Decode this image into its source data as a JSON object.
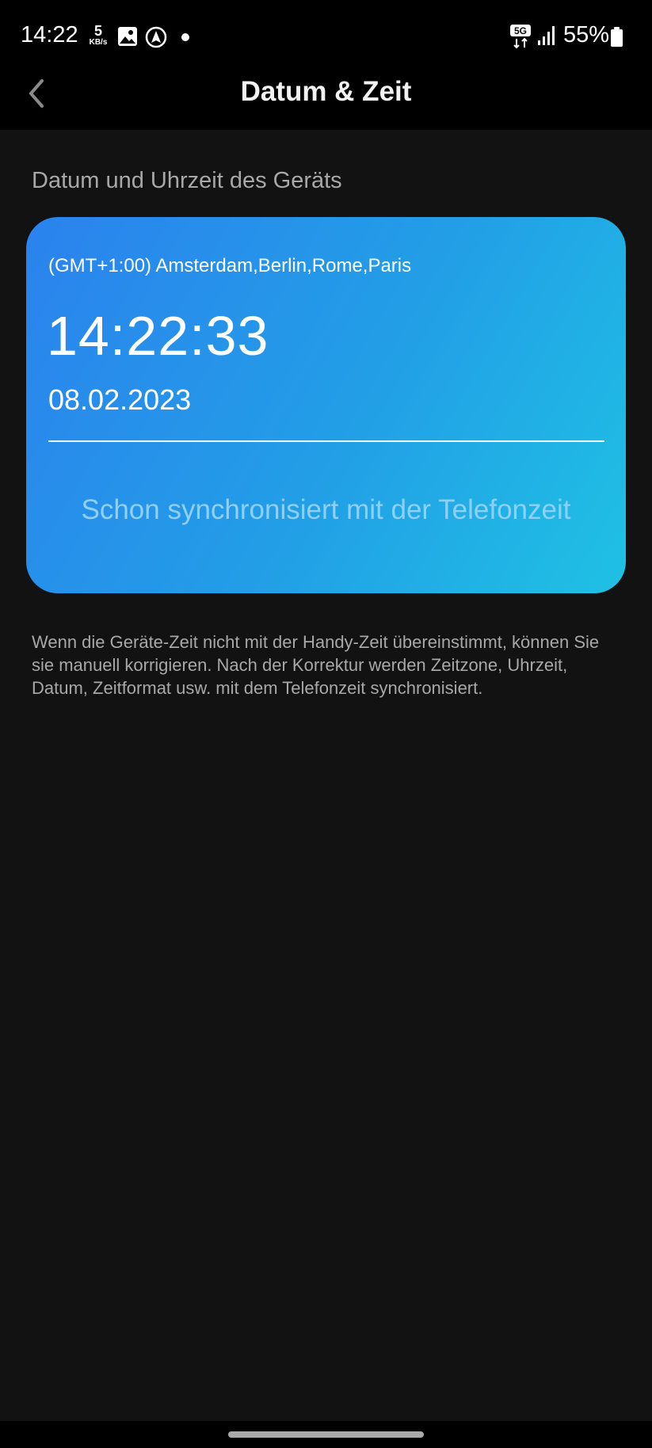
{
  "status_bar": {
    "time": "14:22",
    "net_speed_value": "5",
    "net_speed_unit": "KB/s",
    "network_type": "5G",
    "battery_percent": "55%"
  },
  "header": {
    "title": "Datum & Zeit"
  },
  "section": {
    "label": "Datum und Uhrzeit des Geräts"
  },
  "card": {
    "timezone": "(GMT+1:00) Amsterdam,Berlin,Rome,Paris",
    "time": "14:22:33",
    "date": "08.02.2023",
    "sync_label": "Schon synchronisiert mit der Telefonzeit"
  },
  "info": {
    "text": "Wenn die Geräte-Zeit nicht mit der Handy-Zeit übereinstimmt, können Sie sie manuell korrigieren. Nach der Korrektur werden Zeitzone, Uhrzeit, Datum, Zeitformat usw. mit dem Telefonzeit synchronisiert."
  },
  "colors": {
    "background": "#121212",
    "bar_background": "#000000",
    "card_gradient_start": "#2b82ee",
    "card_gradient_end": "#1fc1e4",
    "sync_text": "#8fd0f7",
    "muted_text": "#a8a8a8"
  },
  "icons": [
    "gallery-icon",
    "navigation-icon",
    "notification-dot-icon",
    "5g-icon",
    "signal-icon",
    "battery-icon",
    "back-chevron-icon"
  ]
}
